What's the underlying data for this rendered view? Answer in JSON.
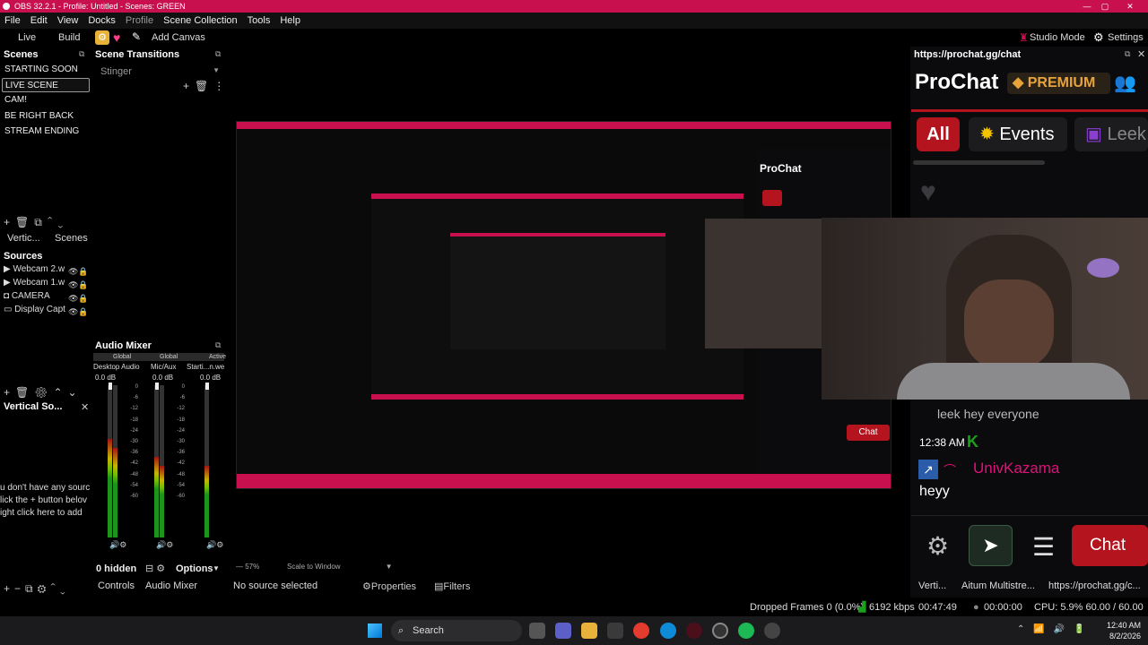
{
  "window": {
    "title": "OBS 32.2.1 - Profile: Untitled - Scenes: GREEN",
    "controls": [
      "—",
      "▢",
      "✕"
    ]
  },
  "menu": [
    "File",
    "Edit",
    "View",
    "Docks",
    "Profile",
    "Scene Collection",
    "Tools",
    "Help"
  ],
  "toolbar": {
    "tabs": [
      "Live",
      "Build"
    ],
    "add_canvas": "Add Canvas",
    "studio_mode": "Studio Mode",
    "settings": "Settings"
  },
  "scenes": {
    "title": "Scenes",
    "items": [
      "STARTING SOON",
      "LIVE SCENE",
      "CAM!",
      "BE RIGHT BACK",
      "STREAM ENDING"
    ],
    "selected": 1,
    "tabs": [
      "Vertic...",
      "Scenes"
    ]
  },
  "transitions": {
    "title": "Scene Transitions",
    "value": "Stinger"
  },
  "sources": {
    "title": "Sources",
    "items": [
      "Webcam 2.w",
      "Webcam 1.w",
      "CAMERA",
      "Display Capt"
    ]
  },
  "vertical_sources": {
    "title": "Vertical So...",
    "empty_lines": [
      "u don't have any sourc",
      "lick the + button belov",
      "ight click here to add"
    ]
  },
  "audio_mixer": {
    "title": "Audio Mixer",
    "channels": [
      {
        "scope": "Global",
        "name": "Desktop Audio",
        "db": "0.0 dB"
      },
      {
        "scope": "Global",
        "name": "Mic/Aux",
        "db": "0.0 dB"
      },
      {
        "scope": "Active",
        "name": "Starti...n.we",
        "db": "0.0 dB"
      }
    ],
    "ticks": [
      "0",
      "-6",
      "-12",
      "-18",
      "-24",
      "-30",
      "-36",
      "-42",
      "-48",
      "-54",
      "-60"
    ],
    "hidden": "0 hidden",
    "options": "Options"
  },
  "bottom_tabs": {
    "controls": "Controls",
    "audio_mixer": "Audio Mixer",
    "no_source": "No source selected",
    "properties": "Properties",
    "filters": "Filters",
    "zoom": "57%",
    "scale": "Scale to Window"
  },
  "chat": {
    "url": "https://prochat.gg/chat",
    "brand": "ProChat",
    "premium": "PREMIUM",
    "tabs": [
      "All",
      "Events",
      "Leek"
    ],
    "partial_msg": "leek hey everyone",
    "time": "12:38 AM",
    "user": "UnivKazama",
    "message": "heyy",
    "chat_button": "Chat",
    "dock_tabs": [
      "Verti...",
      "Aitum Multistre...",
      "https://prochat.gg/c..."
    ]
  },
  "status": {
    "dropped": "Dropped Frames 0 (0.0%)",
    "kbps": "6192 kbps",
    "rec_time": "00:47:49",
    "stream_time": "00:00:00",
    "cpu": "CPU: 5.9% 60.00 / 60.00 FPS"
  },
  "taskbar": {
    "search": "Search",
    "time": "12:40 AM",
    "date": "8/2/2026"
  },
  "colors": {
    "accent": "#c8104f",
    "chat_red": "#b3141d",
    "premium": "#e8a33a",
    "user": "#e0127a",
    "green": "#1aa01a"
  }
}
